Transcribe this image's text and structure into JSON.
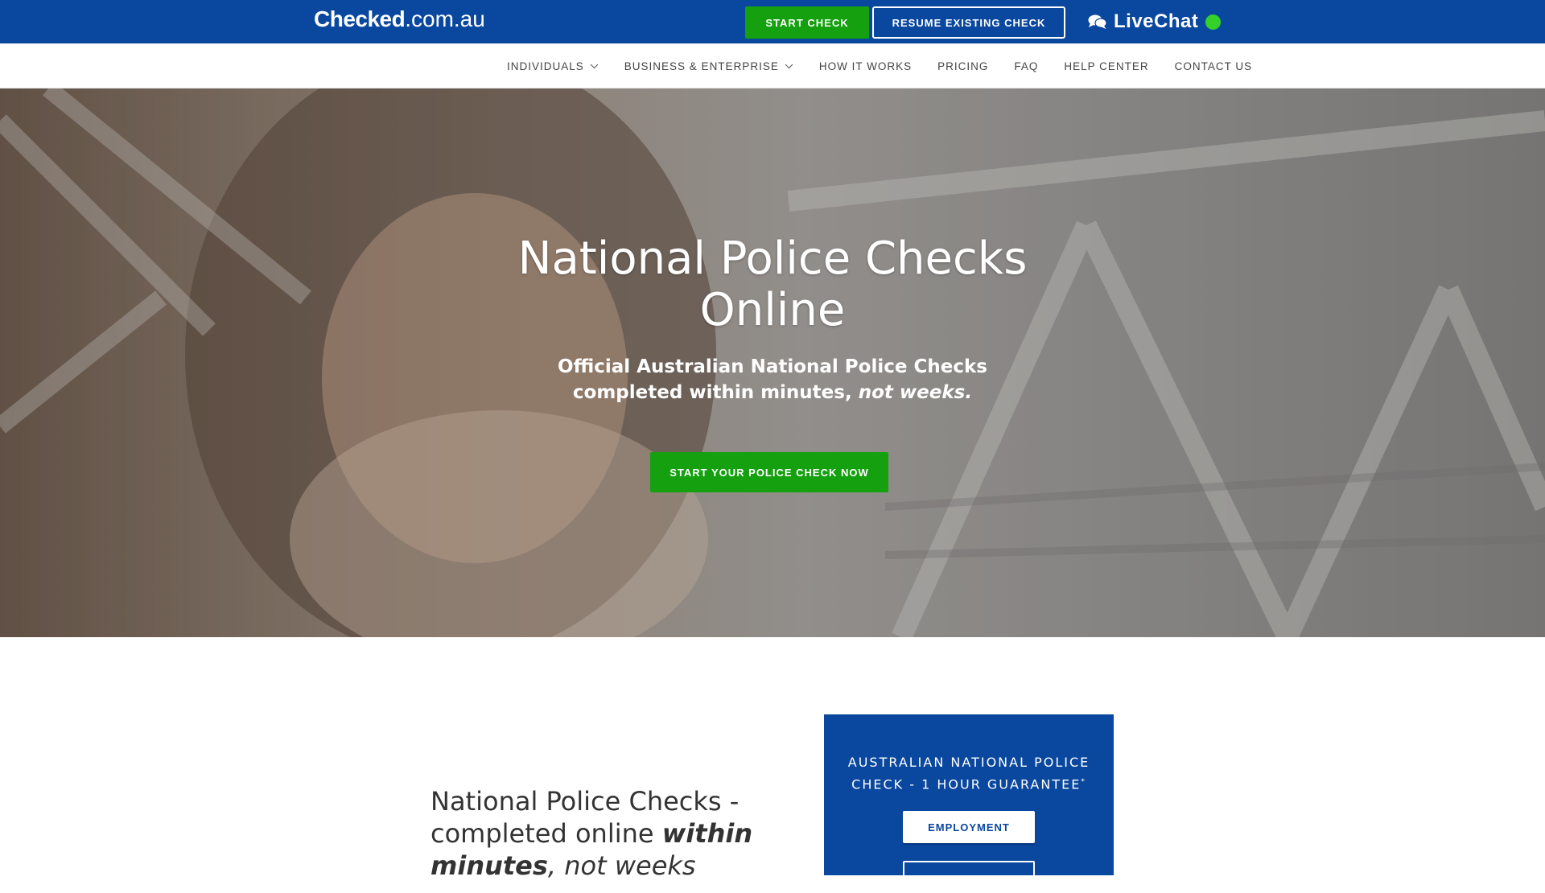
{
  "topbar": {
    "logo_bold": "Checked",
    "logo_light": ".com.au",
    "start_check": "START CHECK",
    "resume_check": "RESUME EXISTING CHECK",
    "livechat": "LiveChat",
    "livechat_icon": "chat-bubbles-icon",
    "livechat_status_color": "#33d12a",
    "bar_color": "#0a479e",
    "accent_green": "#14a00f"
  },
  "nav": {
    "items": [
      {
        "label": "INDIVIDUALS",
        "dropdown": true
      },
      {
        "label": "BUSINESS & ENTERPRISE",
        "dropdown": true
      },
      {
        "label": "HOW IT WORKS",
        "dropdown": false
      },
      {
        "label": "PRICING",
        "dropdown": false
      },
      {
        "label": "FAQ",
        "dropdown": false
      },
      {
        "label": "HELP CENTER",
        "dropdown": false
      },
      {
        "label": "CONTACT US",
        "dropdown": false
      }
    ]
  },
  "hero": {
    "title_line1": "National Police Checks",
    "title_line2": "Online",
    "sub_line1": "Official Australian National Police Checks",
    "sub_line2": "completed within minutes,",
    "sub_emph": "not weeks.",
    "cta": "START YOUR POLICE CHECK NOW"
  },
  "intro": {
    "line1": "National Police Checks -",
    "line2": "completed online",
    "emph": "within minutes",
    "tail": ", not weeks"
  },
  "panel": {
    "title": "AUSTRALIAN NATIONAL POLICE CHECK - 1 HOUR GUARANTEE",
    "title_mark": "*",
    "button": "EMPLOYMENT"
  }
}
